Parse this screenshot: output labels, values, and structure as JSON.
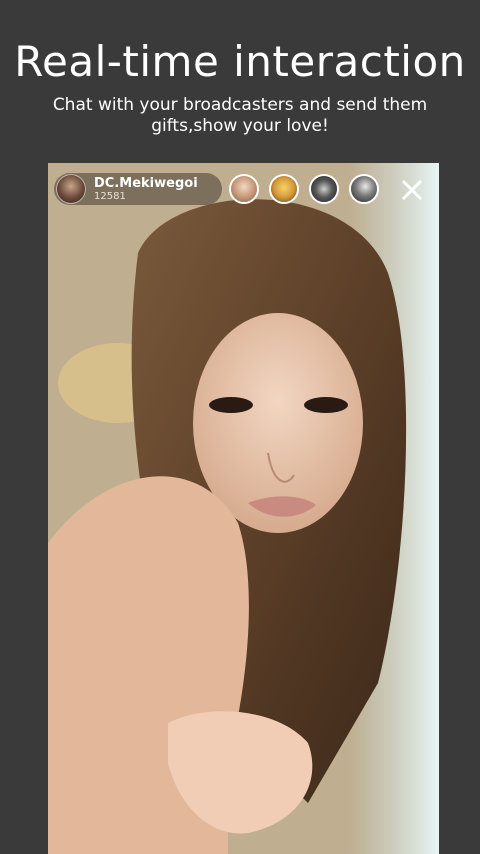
{
  "promo": {
    "title": "Real-time interaction",
    "subtitle": "Chat with your broadcasters and send them gifts,show your love!"
  },
  "live": {
    "host": {
      "name": "DC.Mekiwegoi",
      "count": "12581",
      "avatar_icon": "host-avatar"
    },
    "viewers": [
      {
        "icon": "viewer-avatar"
      },
      {
        "icon": "viewer-avatar"
      },
      {
        "icon": "viewer-avatar"
      },
      {
        "icon": "viewer-avatar"
      }
    ],
    "close_icon": "close-icon"
  },
  "colors": {
    "background": "#3a3a3a",
    "text": "#ffffff"
  }
}
